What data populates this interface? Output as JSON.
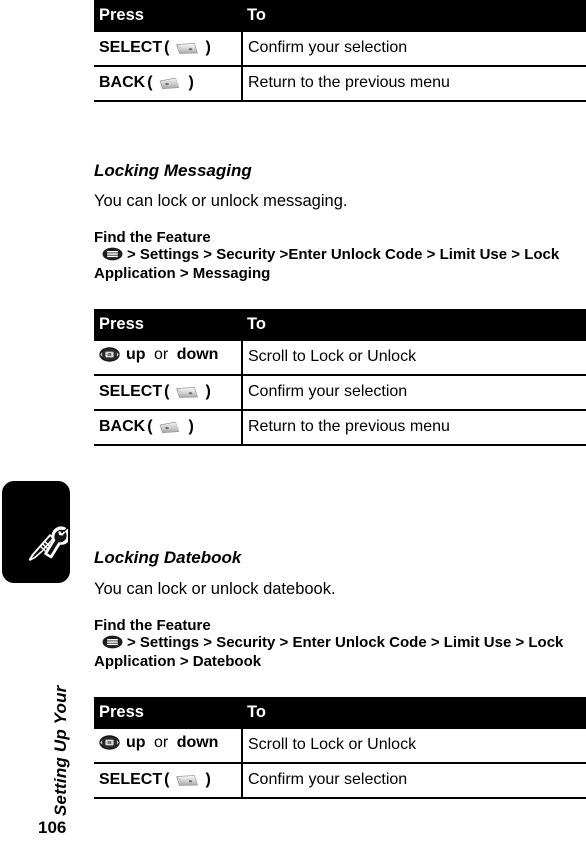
{
  "sidebar": {
    "chapter_label": "Setting Up Your",
    "chapter_icon": "screwdriver-wrench-icon",
    "page_number": "106"
  },
  "tables": {
    "headers": {
      "press": "Press",
      "to": "To"
    },
    "table1": {
      "rows": [
        {
          "press_label": "SELECT",
          "press_icon": "select-softkey-icon",
          "press_open": "(",
          "press_close": ")",
          "to": "Confirm your selection"
        },
        {
          "press_label": "BACK",
          "press_icon": "back-softkey-icon",
          "press_open": "(",
          "press_close": ")",
          "to": "Return to the previous menu"
        }
      ]
    },
    "table2": {
      "rows": [
        {
          "press_icon": "navigation-key-icon",
          "press_label": "up",
          "press_conjunction": "or",
          "press_label2": "down",
          "to": "Scroll to Lock or Unlock"
        },
        {
          "press_label": "SELECT",
          "press_icon": "select-softkey-icon",
          "press_open": "(",
          "press_close": ")",
          "to": "Confirm your selection"
        },
        {
          "press_label": "BACK",
          "press_icon": "back-softkey-icon",
          "press_open": "(",
          "press_close": ")",
          "to": "Return to the previous menu"
        }
      ]
    },
    "table3": {
      "rows": [
        {
          "press_icon": "navigation-key-icon",
          "press_label": "up",
          "press_conjunction": "or",
          "press_label2": "down",
          "to": "Scroll to Lock or Unlock"
        },
        {
          "press_label": "SELECT",
          "press_icon": "select-softkey-icon",
          "press_open": "(",
          "press_close": ")",
          "to": "Confirm your selection"
        }
      ]
    }
  },
  "sections": {
    "messaging": {
      "title": "Locking Messaging",
      "description": "You can lock or unlock messaging.",
      "find_label": "Find the Feature",
      "find_path_line1": "> Settings > Security >Enter Unlock Code > Limit Use > Lock",
      "find_path_line2": "Application > Messaging",
      "menu_icon": "menu-key-icon"
    },
    "datebook": {
      "title": "Locking Datebook",
      "description": "You can lock or unlock datebook.",
      "find_label": "Find the Feature",
      "find_path_line1": "> Settings > Security > Enter Unlock Code > Limit Use > Lock",
      "find_path_line2": "Application > Datebook",
      "menu_icon": "menu-key-icon"
    }
  },
  "colors": {
    "header_bg": "#000000",
    "header_fg": "#ffffff",
    "rule": "#000000",
    "page_bg": "#ffffff"
  }
}
